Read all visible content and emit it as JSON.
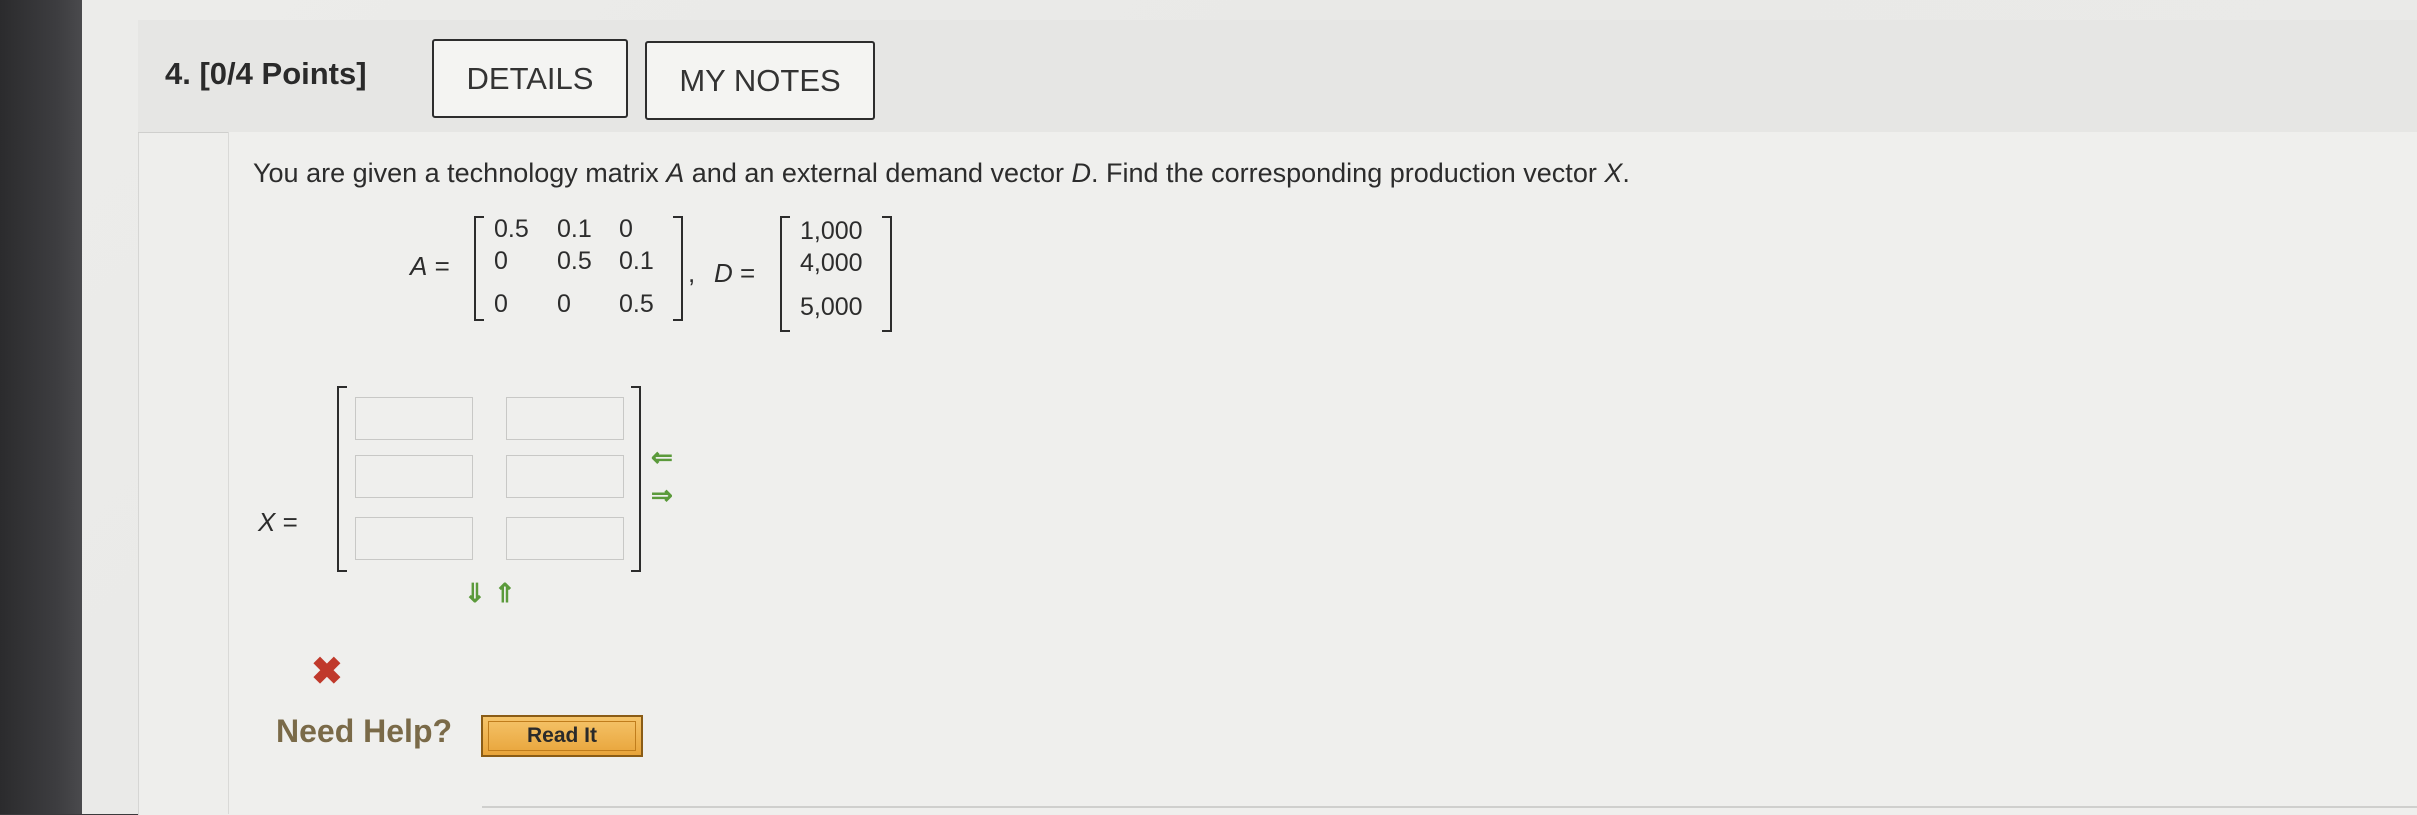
{
  "question": {
    "number_label": "4.",
    "points_label": "[0/4 Points]",
    "details_button": "DETAILS",
    "notes_button": "MY NOTES",
    "prompt_start": "You are given a technology matrix ",
    "prompt_var_a": "A",
    "prompt_mid": " and an external demand vector ",
    "prompt_var_d": "D",
    "prompt_mid2": ". Find the corresponding production vector ",
    "prompt_var_x": "X",
    "prompt_end": "."
  },
  "matrix_a": {
    "label": "A",
    "equals": " =",
    "rows": [
      [
        "0.5",
        "0.1",
        "0"
      ],
      [
        "0",
        "0.5",
        "0.1"
      ],
      [
        "0",
        "0",
        "0.5"
      ]
    ]
  },
  "separator": ",",
  "vector_d": {
    "label": "D",
    "equals": " =",
    "values": [
      "1,000",
      "4,000",
      "5,000"
    ]
  },
  "answer": {
    "label": "X",
    "equals": " =",
    "rows": 3,
    "cols": 2,
    "values": [
      [
        "",
        ""
      ],
      [
        "",
        ""
      ],
      [
        "",
        ""
      ]
    ],
    "col_arrows": [
      "⇐",
      "⇒"
    ],
    "row_arrows": [
      "⇓",
      "⇑"
    ],
    "status_icon": "cross-icon",
    "status_symbol": "✖"
  },
  "help": {
    "label": "Need Help?",
    "read_it_button": "Read It"
  },
  "colors": {
    "arrow_green": "#5b9a3b",
    "wrong_red": "#c0392b",
    "readit_orange": "#e8a43a"
  }
}
